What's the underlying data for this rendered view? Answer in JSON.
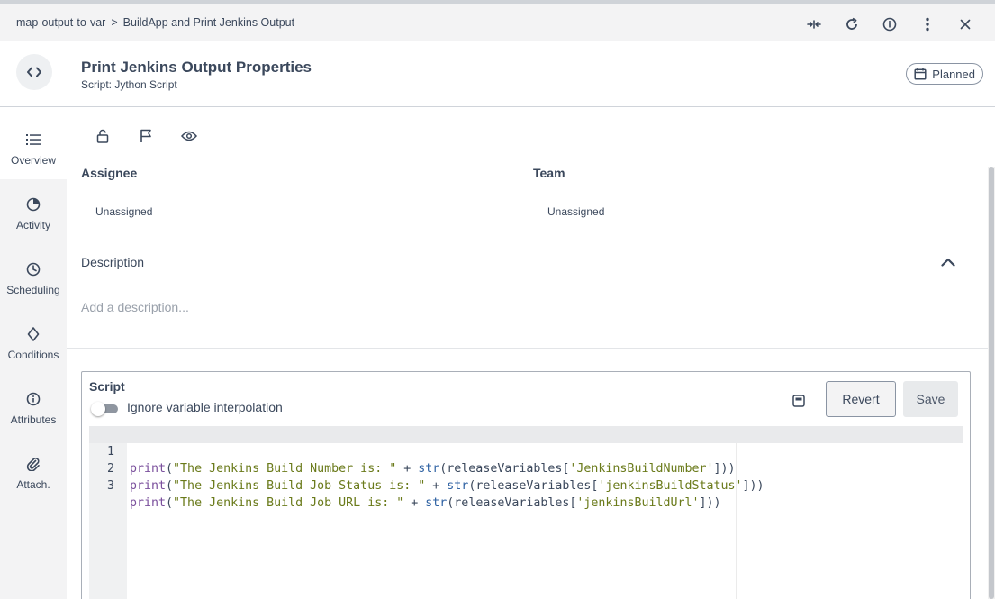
{
  "breadcrumb": {
    "parent": "map-output-to-var",
    "separator": ">",
    "current": "BuildApp and Print Jenkins Output"
  },
  "top_actions": [
    "collapse-arrows-icon",
    "refresh-icon",
    "info-icon",
    "more-vertical-icon",
    "close-icon"
  ],
  "task": {
    "type_icon": "code-icon",
    "title": "Print Jenkins Output Properties",
    "subtitle": "Script: Jython Script",
    "status": "Planned",
    "status_icon": "calendar-icon"
  },
  "sidebar": {
    "items": [
      {
        "id": "overview",
        "label": "Overview",
        "icon": "list-icon",
        "active": true
      },
      {
        "id": "activity",
        "label": "Activity",
        "icon": "pie-chart-icon",
        "active": false
      },
      {
        "id": "scheduling",
        "label": "Scheduling",
        "icon": "clock-icon",
        "active": false
      },
      {
        "id": "conditions",
        "label": "Conditions",
        "icon": "diamond-icon",
        "active": false
      },
      {
        "id": "attributes",
        "label": "Attributes",
        "icon": "info-icon",
        "active": false
      },
      {
        "id": "attach",
        "label": "Attach.",
        "icon": "paperclip-icon",
        "active": false
      }
    ]
  },
  "action_icons": [
    "unlock-icon",
    "flag-icon",
    "eye-icon"
  ],
  "assignee": {
    "label": "Assignee",
    "value": "Unassigned"
  },
  "team": {
    "label": "Team",
    "value": "Unassigned"
  },
  "description": {
    "label": "Description",
    "placeholder": "Add a description..."
  },
  "script": {
    "title": "Script",
    "toggle_label": "Ignore variable interpolation",
    "toggle_on": false,
    "revert_label": "Revert",
    "save_label": "Save",
    "lines": [
      {
        "num": "1",
        "fn": "print",
        "str": "\"The Jenkins Build Number is: \"",
        "op": " + ",
        "bi": "str",
        "arg": "(releaseVariables[",
        "key": "'JenkinsBuildNumber'",
        "tail": "]))"
      },
      {
        "num": "2",
        "fn": "print",
        "str": "\"The Jenkins Build Job Status is: \"",
        "op": " + ",
        "bi": "str",
        "arg": "(releaseVariables[",
        "key": "'jenkinsBuildStatus'",
        "tail": "]))"
      },
      {
        "num": "3",
        "fn": "print",
        "str": "\"The Jenkins Build Job URL is: \"",
        "op": " + ",
        "bi": "str",
        "arg": "(releaseVariables[",
        "key": "'jenkinsBuildUrl'",
        "tail": "]))"
      }
    ]
  },
  "colors": {
    "text": "#3b485c",
    "nav_bg": "#f3f3f4",
    "string": "#6a7a1a",
    "function": "#7a4f9c",
    "builtin": "#2f62a3"
  }
}
